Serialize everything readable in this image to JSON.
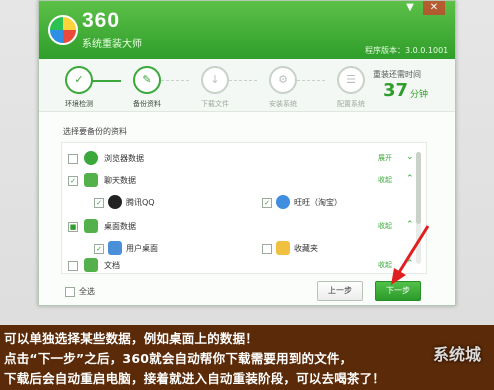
{
  "app": {
    "logo_number": "360",
    "logo_name": "系统重装大师",
    "version": "程序版本：3.0.0.1001",
    "minimize_symbol": "▼",
    "close_symbol": "✕"
  },
  "steps": [
    {
      "label": "环境检测",
      "icon": "✓"
    },
    {
      "label": "备份资料",
      "icon": "✎"
    },
    {
      "label": "下载文件",
      "icon": "↓"
    },
    {
      "label": "安装系统",
      "icon": "⚙"
    },
    {
      "label": "配置系统",
      "icon": "☰"
    }
  ],
  "remaining": {
    "label": "重装还需时间",
    "value": "37",
    "unit": "分钟"
  },
  "backup": {
    "section_title": "选择要备份的资料",
    "browser": {
      "label": "浏览器数据",
      "toggle": "展开",
      "checked": false
    },
    "chat": {
      "label": "聊天数据",
      "toggle": "收起",
      "checked": true,
      "items": [
        {
          "label": "腾讯QQ",
          "checked": true
        },
        {
          "label": "旺旺（淘宝）",
          "checked": true
        }
      ]
    },
    "desktop": {
      "label": "桌面数据",
      "toggle": "收起",
      "checked": true,
      "items": [
        {
          "label": "用户桌面",
          "checked": true
        },
        {
          "label": "收藏夹",
          "checked": false
        }
      ]
    },
    "docs": {
      "label": "文档",
      "toggle": "收起",
      "checked": false
    }
  },
  "footer": {
    "select_all": "全选",
    "prev": "上一步",
    "next": "下一步"
  },
  "caption": {
    "line1": "可以单独选择某些数据，例如桌面上的数据！",
    "line2": "点击“下一步”之后，360就会自动帮你下载需要用到的文件，",
    "line3": "下载后会自动重启电脑，接着就进入自动重装阶段，可以去喝茶了！"
  },
  "watermark": "系统城",
  "colors": {
    "accent": "#2f9e2a",
    "caption_bg": "#5b2a08",
    "arrow": "#e02020"
  }
}
